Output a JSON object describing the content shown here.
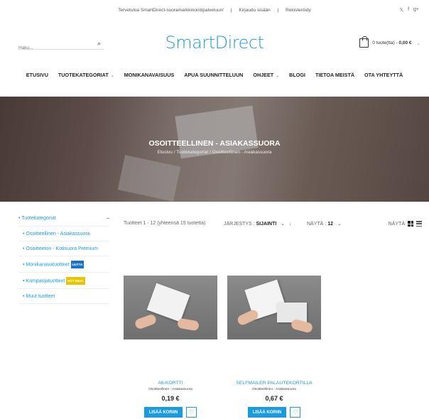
{
  "topbar": {
    "welcome": "Tervetuloa SmartDirect-suoramarkkinointipalveluun!",
    "sep1": "|",
    "login": "Kirjaudu sisään",
    "sep2": "|",
    "register": "Rekisteröidy",
    "social": [
      "twitter-icon",
      "facebook-icon",
      "google-plus-icon"
    ],
    "social_glyphs": [
      "𝕏",
      "f",
      "g+"
    ]
  },
  "header": {
    "search_placeholder": "Haku...",
    "logo": "SmartDirect",
    "cart_count": "0 tuote(tta) - ",
    "cart_total": "0,00 €"
  },
  "nav": {
    "items": [
      {
        "label": "ETUSIVU",
        "caret": ""
      },
      {
        "label": "TUOTEKATEGORIAT",
        "caret": "⌄"
      },
      {
        "label": "MONIKANAVAISUUS",
        "caret": ""
      },
      {
        "label": "APUA SUUNNITTELUUN",
        "caret": ""
      },
      {
        "label": "OHJEET",
        "caret": "⌄"
      },
      {
        "label": "BLOGI",
        "caret": ""
      },
      {
        "label": "TIETOA MEISTÄ",
        "caret": ""
      },
      {
        "label": "OTA YHTEYTTÄ",
        "caret": ""
      }
    ]
  },
  "hero": {
    "title": "OSOITTEELLINEN - ASIAKASSUORA",
    "breadcrumb": "Etusivu / Tuotekategoriat / Osoitteellinen - Asiakassuora"
  },
  "sidebar": {
    "heading": "Tuotekategoriat",
    "toggle": "–",
    "items": [
      {
        "label": "Osoitteellinen - Asiakassuora",
        "badge": "",
        "badge_color": ""
      },
      {
        "label": "Osoitteeton - Kotisuora Premium",
        "badge": "",
        "badge_color": ""
      },
      {
        "label": "Monikanavatuotteet",
        "badge": "UUTTA",
        "badge_color": "#1a73c9"
      },
      {
        "label": "Kampanjatuotteet",
        "badge": "HOT DEAL",
        "badge_color": "#e9c400"
      },
      {
        "label": "Muut tuotteet",
        "badge": "",
        "badge_color": ""
      }
    ]
  },
  "toolbar": {
    "count": "Tuotteet 1 - 12 (yhteensä 15 tuotetta)",
    "sort_label": "JÄRJESTYS : ",
    "sort_value": "SIJAINTI",
    "sort_dir": "↓",
    "show_label": "NÄYTÄ : ",
    "show_value": "12",
    "view_label": "NÄYTÄ"
  },
  "products": [
    {
      "name": "A6-KORTTI",
      "category": "Osoitteellinen - Asiakassuora",
      "price": "0,19 €",
      "add_label": "LISÄÄ KORIIN"
    },
    {
      "name": "SELFMAILER PALAUTEKORTILLA",
      "category": "Osoitteellinen - Asiakassuora",
      "price": "0,67 €",
      "add_label": "LISÄÄ KORIIN"
    }
  ],
  "colors": {
    "accent": "#1a9be0"
  }
}
